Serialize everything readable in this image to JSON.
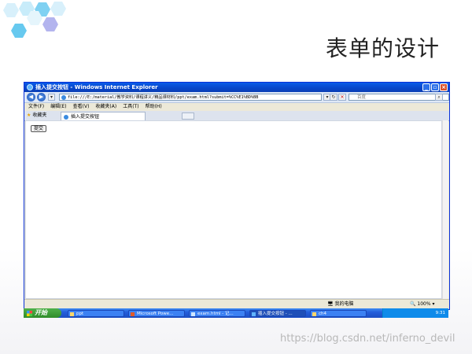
{
  "slide": {
    "title": "表单的设计",
    "watermark": "https://blog.csdn.net/inferno_devil"
  },
  "browser": {
    "window_title": "插入提交按钮 - Windows Internet Explorer",
    "address": "file:///E:/material/教学资料/课程讲义/精品课材料/ppt/exam.html?submit=%CC%E1%BD%BB",
    "search_placeholder": "百度",
    "menu": [
      "文件(F)",
      "编辑(E)",
      "查看(V)",
      "收藏夹(A)",
      "工具(T)",
      "帮助(H)"
    ],
    "favorites_label": "收藏夹",
    "tab_label": "插入提交按钮",
    "page_button_label": "提交",
    "status_zone": "我的电脑",
    "zoom": "100%"
  },
  "taskbar": {
    "start_label": "开始",
    "items": [
      "ppt",
      "Microsoft Powe...",
      "exam.html - 记...",
      "插入提交按钮 - ...",
      "ch4"
    ],
    "clock": "9:31"
  }
}
